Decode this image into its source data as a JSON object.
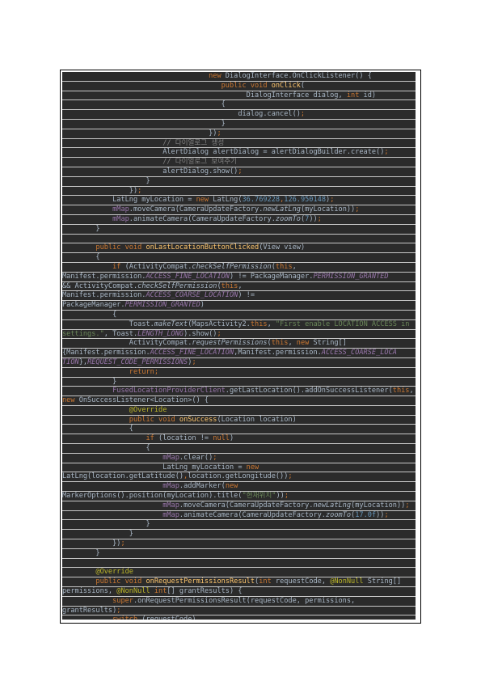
{
  "document": {
    "language": "java",
    "lines": [
      {
        "i": "                                   ",
        "t": [
          [
            "new ",
            "k"
          ],
          [
            "DialogInterface.OnClickListener() {",
            ""
          ]
        ]
      },
      {
        "i": "                                      ",
        "t": [
          [
            "public void ",
            "k"
          ],
          [
            "onClick",
            "f"
          ],
          [
            "(",
            ""
          ]
        ]
      },
      {
        "i": "                                            ",
        "t": [
          [
            "DialogInterface dialog, ",
            ""
          ],
          [
            "int ",
            "k"
          ],
          [
            "id)",
            ""
          ]
        ]
      },
      {
        "i": "                                      ",
        "t": [
          [
            "{",
            ""
          ]
        ]
      },
      {
        "i": "                                          ",
        "t": [
          [
            "dialog.cancel()",
            ""
          ],
          [
            ";",
            "k"
          ]
        ]
      },
      {
        "i": "                                      ",
        "t": [
          [
            "}",
            ""
          ]
        ]
      },
      {
        "i": "                                   ",
        "t": [
          [
            "})",
            ""
          ],
          [
            ";",
            "k"
          ]
        ]
      },
      {
        "i": "                        ",
        "t": [
          [
            "// 다이얼로그 생성",
            "c"
          ]
        ]
      },
      {
        "i": "                        ",
        "t": [
          [
            "AlertDialog alertDialog = alertDialogBuilder.create()",
            ""
          ],
          [
            ";",
            "k"
          ]
        ]
      },
      {
        "i": "                        ",
        "t": [
          [
            "// 다이얼로그 보여주기",
            "c"
          ]
        ]
      },
      {
        "i": "                        ",
        "t": [
          [
            "alertDialog.show()",
            ""
          ],
          [
            ";",
            "k"
          ]
        ]
      },
      {
        "i": "                    ",
        "t": [
          [
            "}",
            ""
          ]
        ]
      },
      {
        "i": "                ",
        "t": [
          [
            "})",
            ""
          ],
          [
            ";",
            "k"
          ]
        ]
      },
      {
        "i": "            ",
        "t": [
          [
            "LatLng myLocation = ",
            ""
          ],
          [
            "new ",
            "k"
          ],
          [
            "LatLng(",
            ""
          ],
          [
            "36.769228",
            "n"
          ],
          [
            ",",
            "k"
          ],
          [
            "126.950148",
            "n"
          ],
          [
            ")",
            ""
          ],
          [
            ";",
            "k"
          ]
        ]
      },
      {
        "i": "            ",
        "t": [
          [
            "mMap",
            "m"
          ],
          [
            ".moveCamera(CameraUpdateFactory.",
            ""
          ],
          [
            "newLatLng",
            "it"
          ],
          [
            "(myLocation))",
            ""
          ],
          [
            ";",
            "k"
          ]
        ]
      },
      {
        "i": "            ",
        "t": [
          [
            "mMap",
            "m"
          ],
          [
            ".animateCamera(CameraUpdateFactory.",
            ""
          ],
          [
            "zoomTo",
            "it"
          ],
          [
            "(",
            ""
          ],
          [
            "7",
            "n"
          ],
          [
            "))",
            ""
          ],
          [
            ";",
            "k"
          ]
        ]
      },
      {
        "i": "        ",
        "t": [
          [
            "}",
            ""
          ]
        ]
      },
      {
        "i": "",
        "t": [
          [
            "",
            ""
          ]
        ]
      },
      {
        "i": "        ",
        "t": [
          [
            "public void ",
            "k"
          ],
          [
            "onLastLocationButtonClicked",
            "f"
          ],
          [
            "(View view)",
            ""
          ]
        ]
      },
      {
        "i": "        ",
        "t": [
          [
            "{",
            ""
          ]
        ]
      },
      {
        "i": "            ",
        "t": [
          [
            "if ",
            "k"
          ],
          [
            "(ActivityCompat.",
            ""
          ],
          [
            "checkSelfPermission",
            "it"
          ],
          [
            "(",
            ""
          ],
          [
            "this",
            "k"
          ],
          [
            ",",
            ""
          ]
        ]
      },
      {
        "i": "",
        "t": [
          [
            "Manifest.permission.",
            ""
          ],
          [
            "ACCESS_FINE_LOCATION",
            "i"
          ],
          [
            ") != PackageManager.",
            ""
          ],
          [
            "PERMISSION_GRANTED",
            "i"
          ]
        ]
      },
      {
        "i": "",
        "t": [
          [
            "&& ActivityCompat.",
            ""
          ],
          [
            "checkSelfPermission",
            "it"
          ],
          [
            "(",
            ""
          ],
          [
            "this",
            "k"
          ],
          [
            ",",
            ""
          ]
        ]
      },
      {
        "i": "",
        "t": [
          [
            "Manifest.permission.",
            ""
          ],
          [
            "ACCESS_COARSE_LOCATION",
            "i"
          ],
          [
            ") !=",
            ""
          ]
        ]
      },
      {
        "i": "",
        "t": [
          [
            "PackageManager.",
            ""
          ],
          [
            "PERMISSION_GRANTED",
            "i"
          ],
          [
            ")",
            ""
          ]
        ]
      },
      {
        "i": "            ",
        "t": [
          [
            "{",
            ""
          ]
        ]
      },
      {
        "i": "                ",
        "t": [
          [
            "Toast.",
            ""
          ],
          [
            "makeText",
            "it"
          ],
          [
            "(MapsActivity2.",
            ""
          ],
          [
            "this",
            "k"
          ],
          [
            ", ",
            ""
          ],
          [
            "\"First enable LOCATION ACCESS in",
            "s"
          ]
        ]
      },
      {
        "i": "",
        "t": [
          [
            "settings.\"",
            "s"
          ],
          [
            ", Toast.",
            ""
          ],
          [
            "LENGTH_LONG",
            "i"
          ],
          [
            ").show()",
            ""
          ],
          [
            ";",
            "k"
          ]
        ]
      },
      {
        "i": "                ",
        "t": [
          [
            "ActivityCompat.",
            ""
          ],
          [
            "requestPermissions",
            "it"
          ],
          [
            "(",
            ""
          ],
          [
            "this",
            "k"
          ],
          [
            ", ",
            ""
          ],
          [
            "new ",
            "k"
          ],
          [
            "String[]",
            ""
          ]
        ]
      },
      {
        "i": "",
        "t": [
          [
            "{Manifest.permission.",
            ""
          ],
          [
            "ACCESS_FINE_LOCATION",
            "i"
          ],
          [
            ",Manifest.permission.",
            ""
          ],
          [
            "ACCESS_COARSE_LOCA",
            "i"
          ]
        ]
      },
      {
        "i": "",
        "t": [
          [
            "TION",
            "i"
          ],
          [
            "},",
            ""
          ],
          [
            "REQUEST_CODE_PERMISSIONS",
            "i"
          ],
          [
            ")",
            ""
          ],
          [
            ";",
            "k"
          ]
        ]
      },
      {
        "i": "                ",
        "t": [
          [
            "return",
            "k"
          ],
          [
            ";",
            "k"
          ]
        ]
      },
      {
        "i": "            ",
        "t": [
          [
            "}",
            ""
          ]
        ]
      },
      {
        "i": "            ",
        "t": [
          [
            "FusedLocationProviderClient",
            "m"
          ],
          [
            ".getLastLocation().addOnSuccessListener(",
            ""
          ],
          [
            "this",
            "k"
          ],
          [
            ",",
            ""
          ]
        ]
      },
      {
        "i": "",
        "t": [
          [
            "new ",
            "k"
          ],
          [
            "OnSuccessListener<Location>() {",
            ""
          ]
        ]
      },
      {
        "i": "                ",
        "t": [
          [
            "@Override",
            "a"
          ]
        ]
      },
      {
        "i": "                ",
        "t": [
          [
            "public void ",
            "k"
          ],
          [
            "onSuccess",
            "f"
          ],
          [
            "(Location location)",
            ""
          ]
        ]
      },
      {
        "i": "                ",
        "t": [
          [
            "{",
            ""
          ]
        ]
      },
      {
        "i": "                    ",
        "t": [
          [
            "if ",
            "k"
          ],
          [
            "(location != ",
            ""
          ],
          [
            "null",
            "k"
          ],
          [
            ")",
            ""
          ]
        ]
      },
      {
        "i": "                    ",
        "t": [
          [
            "{",
            ""
          ]
        ]
      },
      {
        "i": "                        ",
        "t": [
          [
            "mMap",
            "m"
          ],
          [
            ".clear()",
            ""
          ],
          [
            ";",
            "k"
          ]
        ]
      },
      {
        "i": "                        ",
        "t": [
          [
            "LatLng myLocation = ",
            ""
          ],
          [
            "new",
            "k"
          ]
        ]
      },
      {
        "i": "",
        "t": [
          [
            "LatLng(location.getLatitude()",
            ""
          ],
          [
            ",",
            "k"
          ],
          [
            "location.getLongitude())",
            ""
          ],
          [
            ";",
            "k"
          ]
        ]
      },
      {
        "i": "                        ",
        "t": [
          [
            "mMap",
            "m"
          ],
          [
            ".addMarker(",
            ""
          ],
          [
            "new",
            "k"
          ]
        ]
      },
      {
        "i": "",
        "t": [
          [
            "MarkerOptions().position(myLocation).title(",
            ""
          ],
          [
            "\"현재위치\"",
            "s"
          ],
          [
            "))",
            ""
          ],
          [
            ";",
            "k"
          ]
        ]
      },
      {
        "i": "                        ",
        "t": [
          [
            "mMap",
            "m"
          ],
          [
            ".moveCamera(CameraUpdateFactory.",
            ""
          ],
          [
            "newLatLng",
            "it"
          ],
          [
            "(myLocation))",
            ""
          ],
          [
            ";",
            "k"
          ]
        ]
      },
      {
        "i": "                        ",
        "t": [
          [
            "mMap",
            "m"
          ],
          [
            ".animateCamera(CameraUpdateFactory.",
            ""
          ],
          [
            "zoomTo",
            "it"
          ],
          [
            "(",
            ""
          ],
          [
            "17.0f",
            "n"
          ],
          [
            "))",
            ""
          ],
          [
            ";",
            "k"
          ]
        ]
      },
      {
        "i": "                    ",
        "t": [
          [
            "}",
            ""
          ]
        ]
      },
      {
        "i": "                ",
        "t": [
          [
            "}",
            ""
          ]
        ]
      },
      {
        "i": "            ",
        "t": [
          [
            "})",
            ""
          ],
          [
            ";",
            "k"
          ]
        ]
      },
      {
        "i": "        ",
        "t": [
          [
            "}",
            ""
          ]
        ]
      },
      {
        "i": "",
        "t": [
          [
            "",
            ""
          ]
        ]
      },
      {
        "i": "        ",
        "t": [
          [
            "@Override",
            "a"
          ]
        ]
      },
      {
        "i": "        ",
        "t": [
          [
            "public void ",
            "k"
          ],
          [
            "onRequestPermissionsResult",
            "f"
          ],
          [
            "(",
            ""
          ],
          [
            "int ",
            "k"
          ],
          [
            "requestCode, ",
            ""
          ],
          [
            "@NonNull ",
            "a"
          ],
          [
            "String[]",
            ""
          ]
        ]
      },
      {
        "i": "",
        "t": [
          [
            "permissions, ",
            ""
          ],
          [
            "@NonNull ",
            "a"
          ],
          [
            "int",
            "k"
          ],
          [
            "[] grantResults) {",
            ""
          ]
        ]
      },
      {
        "i": "            ",
        "t": [
          [
            "super",
            "k"
          ],
          [
            ".onRequestPermissionsResult(requestCode, permissions,",
            ""
          ]
        ]
      },
      {
        "i": "",
        "t": [
          [
            "grantResults)",
            ""
          ],
          [
            ";",
            "k"
          ]
        ]
      },
      {
        "i": "            ",
        "t": [
          [
            "switch ",
            "k"
          ],
          [
            "(requestCode)",
            ""
          ]
        ]
      }
    ]
  }
}
